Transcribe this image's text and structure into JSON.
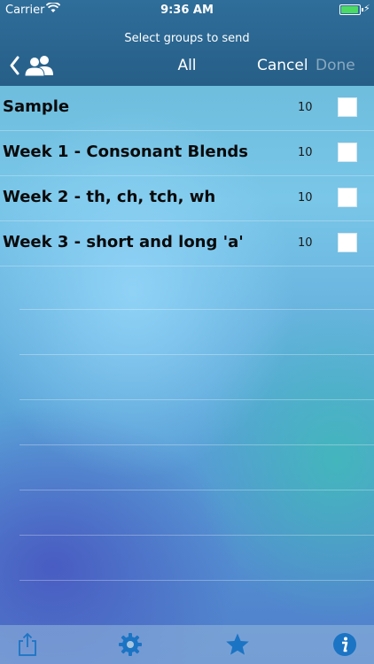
{
  "status_bar": {
    "carrier": "Carrier",
    "time": "9:36 AM"
  },
  "header": {
    "subtitle": "Select groups to send",
    "title": "All",
    "cancel_label": "Cancel",
    "done_label": "Done"
  },
  "groups": [
    {
      "name": "Sample",
      "count": "10"
    },
    {
      "name": "Week 1 - Consonant Blends",
      "count": "10"
    },
    {
      "name": "Week 2 - th, ch, tch, wh",
      "count": "10"
    },
    {
      "name": "Week 3 - short and long 'a'",
      "count": "10"
    }
  ],
  "toolbar": {
    "items": [
      "share-icon",
      "gear-icon",
      "star-icon",
      "info-icon"
    ]
  },
  "colors": {
    "header_bg": "#2a668f",
    "toolbar_icon": "#1b74c4",
    "done_disabled": "#9ab8cc"
  }
}
